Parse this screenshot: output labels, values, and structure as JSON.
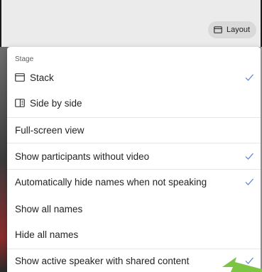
{
  "layout_button": {
    "label": "Layout",
    "icon": "layout-icon"
  },
  "menu": {
    "section_label": "Stage",
    "items": [
      {
        "label": "Stack",
        "icon": "stack-icon",
        "checked": true
      },
      {
        "label": "Side by side",
        "icon": "side-by-side-icon",
        "checked": false
      },
      {
        "label": "Full-screen view",
        "checked": false
      },
      {
        "label": "Show participants without video",
        "checked": true
      },
      {
        "label": "Automatically hide names when not speaking",
        "checked": true
      },
      {
        "label": "Show all names",
        "checked": false
      },
      {
        "label": "Hide all names",
        "checked": false
      },
      {
        "label": "Show active speaker with shared content",
        "checked": true
      }
    ]
  },
  "colors": {
    "accent": "#5b7fd1",
    "menu_background": "#ffffff",
    "topbar_background": "#ebebeb",
    "pointer": "#7cc444"
  }
}
